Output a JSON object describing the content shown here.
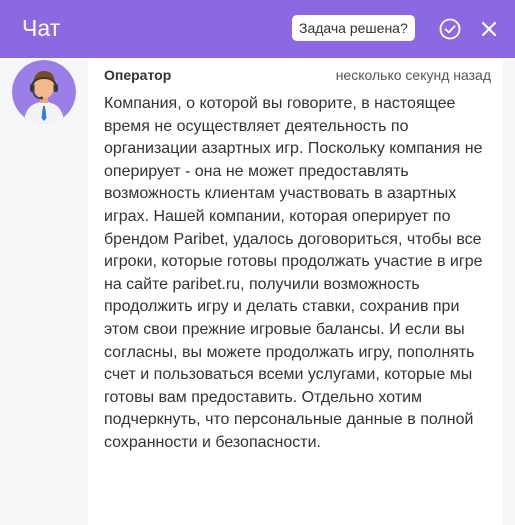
{
  "header": {
    "title": "Чат",
    "solved_question": "Задача решена?",
    "check_icon": "check-circle-icon",
    "close_icon": "close-icon",
    "background": "#8d68e3"
  },
  "message": {
    "sender": "Оператор",
    "time": "несколько секунд назад",
    "avatar_icon": "operator-avatar",
    "text": "Компания, о которой вы говорите, в настоящее время не осуществляет деятельность по организации азартных игр. Поскольку компания не оперирует - она не может предоставлять возможность клиентам участвовать в азартных играх. Нашей компании, которая оперирует по брендом Paribet, удалось договориться, чтобы все игроки, которые готовы продолжать участие в игре на сайте paribet.ru, получили возможность продолжить игру и делать ставки, сохранив при этом свои прежние игровые балансы. И если вы согласны, вы можете продолжать игру, пополнять счет и пользоваться всеми услугами, которые мы готовы вам предоставить. Отдельно хотим подчеркнуть, что персональные данные в полной сохранности и безопасности."
  }
}
